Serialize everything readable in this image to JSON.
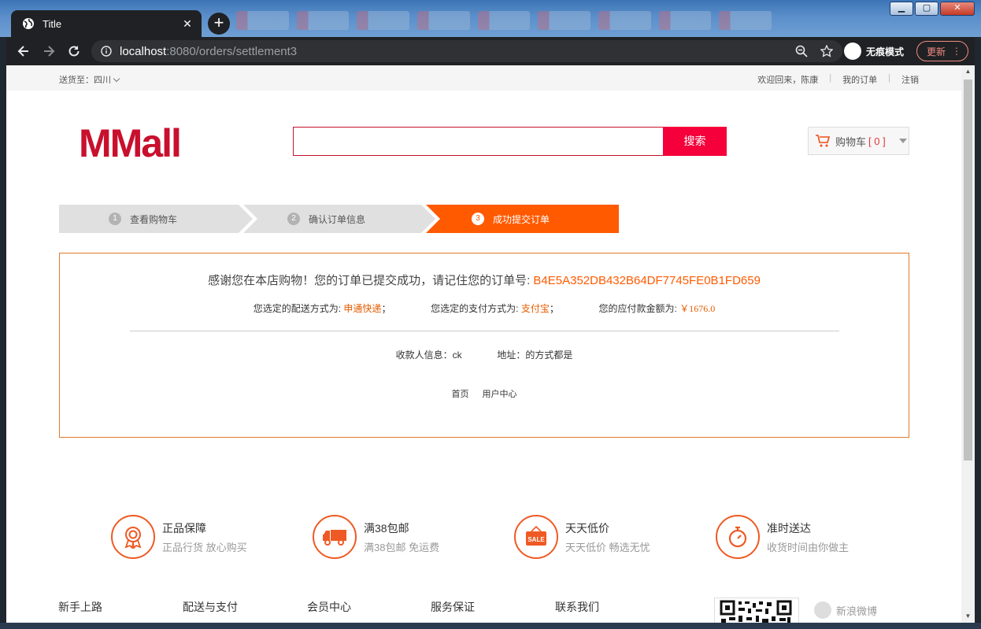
{
  "browser": {
    "tab_title": "Title",
    "url_host": "localhost",
    "url_path": ":8080/orders/settlement3",
    "incognito_label": "无痕模式",
    "update_label": "更新"
  },
  "topbar": {
    "ship_to_label": "送货至：",
    "ship_to_region": "四川",
    "welcome": "欢迎回来，陈康",
    "my_orders": "我的订单",
    "logout": "注销"
  },
  "header": {
    "logo": "MMall",
    "search_value": "",
    "search_button": "搜索",
    "cart_label": "购物车",
    "cart_count": "[ 0 ]"
  },
  "steps": [
    {
      "num": "1",
      "label": "查看购物车",
      "active": false
    },
    {
      "num": "2",
      "label": "确认订单信息",
      "active": false
    },
    {
      "num": "3",
      "label": "成功提交订单",
      "active": true
    }
  ],
  "order": {
    "thanks_text": "感谢您在本店购物！您的订单已提交成功，请记住您的订单号:",
    "order_number": "B4E5A352DB432B64DF7745FE0B1FD659",
    "delivery_label": "您选定的配送方式为:",
    "delivery_value": "申通快递",
    "payment_label": "您选定的支付方式为:",
    "payment_value": "支付宝",
    "amount_label": "您的应付款金额为:",
    "amount_value": "￥1676.0",
    "semicolon": "；",
    "receiver_label": "收款人信息：",
    "receiver_value": "ck",
    "address_label": "地址：",
    "address_value": "的方式都是",
    "link_home": "首页",
    "link_user_center": "用户中心"
  },
  "features": [
    {
      "icon": "ribbon-icon",
      "title": "正品保障",
      "sub": "正品行货 放心购买"
    },
    {
      "icon": "truck-icon",
      "title": "满38包邮",
      "sub": "满38包邮 免运费"
    },
    {
      "icon": "sale-tag-icon",
      "title": "天天低价",
      "sub": "天天低价 畅选无忧"
    },
    {
      "icon": "stopwatch-icon",
      "title": "准时送达",
      "sub": "收货时间由你做主"
    }
  ],
  "footer": {
    "columns": [
      "新手上路",
      "配送与支付",
      "会员中心",
      "服务保证",
      "联系我们"
    ],
    "weibo": "新浪微博"
  },
  "colors": {
    "brand_red": "#c8102e",
    "search_button": "#f5003a",
    "step_active": "#ff5a00",
    "accent_orange": "#ef5a24"
  }
}
